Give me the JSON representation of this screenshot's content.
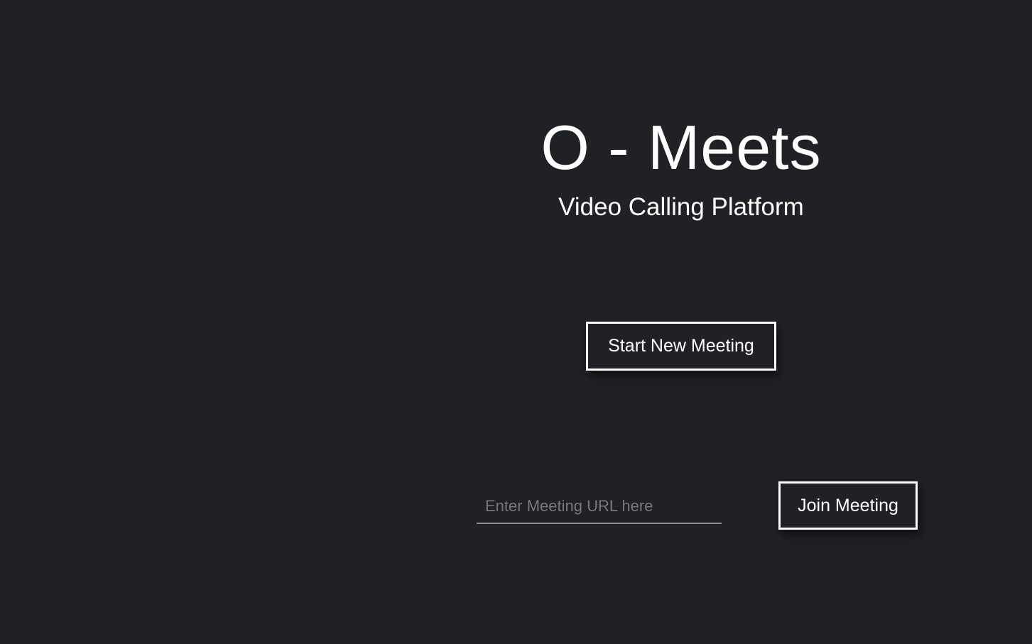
{
  "header": {
    "title": "O - Meets",
    "subtitle": "Video Calling Platform"
  },
  "actions": {
    "start_label": "Start New Meeting",
    "join_label": "Join Meeting"
  },
  "url_input": {
    "value": "",
    "placeholder": "Enter Meeting URL here"
  }
}
